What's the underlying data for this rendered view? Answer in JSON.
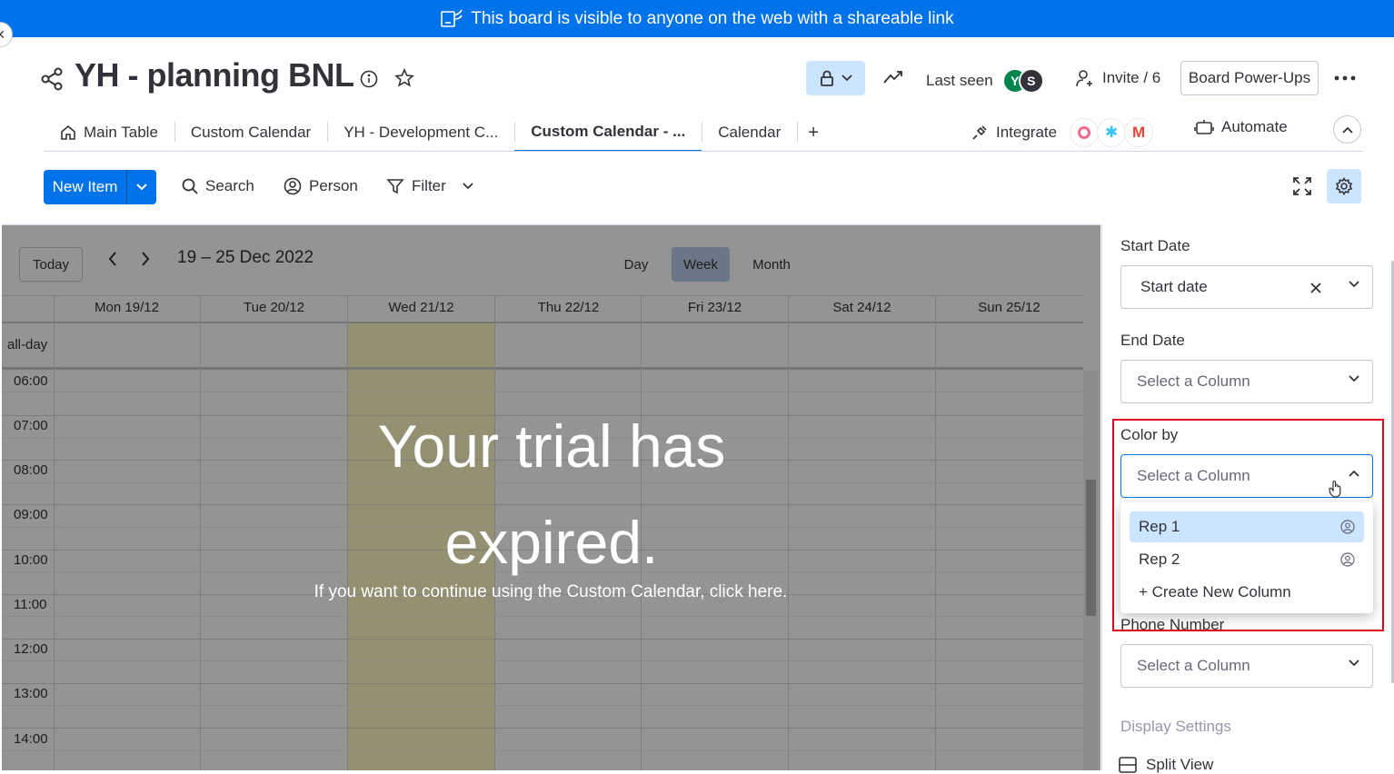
{
  "banner": {
    "text": "This board is visible to anyone on the web with a shareable link"
  },
  "header": {
    "title": "YH - planning BNL",
    "last_seen_label": "Last seen",
    "avatars": [
      {
        "initial": "Y",
        "color": "#00854d"
      },
      {
        "initial": "S",
        "color": "#323338"
      }
    ],
    "invite_label": "Invite / 6",
    "powerups_label": "Board Power-Ups"
  },
  "tabs": [
    {
      "label": "Main Table"
    },
    {
      "label": "Custom Calendar"
    },
    {
      "label": "YH - Development C..."
    },
    {
      "label": "Custom Calendar - ..."
    },
    {
      "label": "Calendar"
    },
    {
      "label": "+"
    }
  ],
  "integrate_label": "Integrate",
  "automate_label": "Automate",
  "toolbar": {
    "new_item": "New Item",
    "search": "Search",
    "person": "Person",
    "filter": "Filter"
  },
  "calendar": {
    "today": "Today",
    "range": "19 – 25 Dec 2022",
    "views": [
      "Day",
      "Week",
      "Month"
    ],
    "active_view": "Week",
    "days": [
      "Mon 19/12",
      "Tue 20/12",
      "Wed 21/12",
      "Thu 22/12",
      "Fri 23/12",
      "Sat 24/12",
      "Sun 25/12"
    ],
    "all_day": "all-day",
    "times": [
      "06:00",
      "07:00",
      "08:00",
      "09:00",
      "10:00",
      "11:00",
      "12:00",
      "13:00",
      "14:00"
    ],
    "trial_title": "Your trial has expired.",
    "trial_text": "If you want to continue using the Custom Calendar, click here."
  },
  "settings": {
    "start_date": {
      "label": "Start Date",
      "value": "Start date"
    },
    "end_date": {
      "label": "End Date",
      "placeholder": "Select a Column"
    },
    "color_by": {
      "label": "Color by",
      "placeholder": "Select a Column"
    },
    "color_options": [
      {
        "label": "Rep 1"
      },
      {
        "label": "Rep 2"
      },
      {
        "label": "+ Create New Column"
      }
    ],
    "phone": {
      "label": "Phone Number",
      "placeholder": "Select a Column"
    },
    "display_settings": "Display Settings",
    "split_view": "Split View"
  },
  "colors": {
    "primary": "#0073ea",
    "highlight": "#e2001a",
    "today_column": "#fff8c5"
  }
}
